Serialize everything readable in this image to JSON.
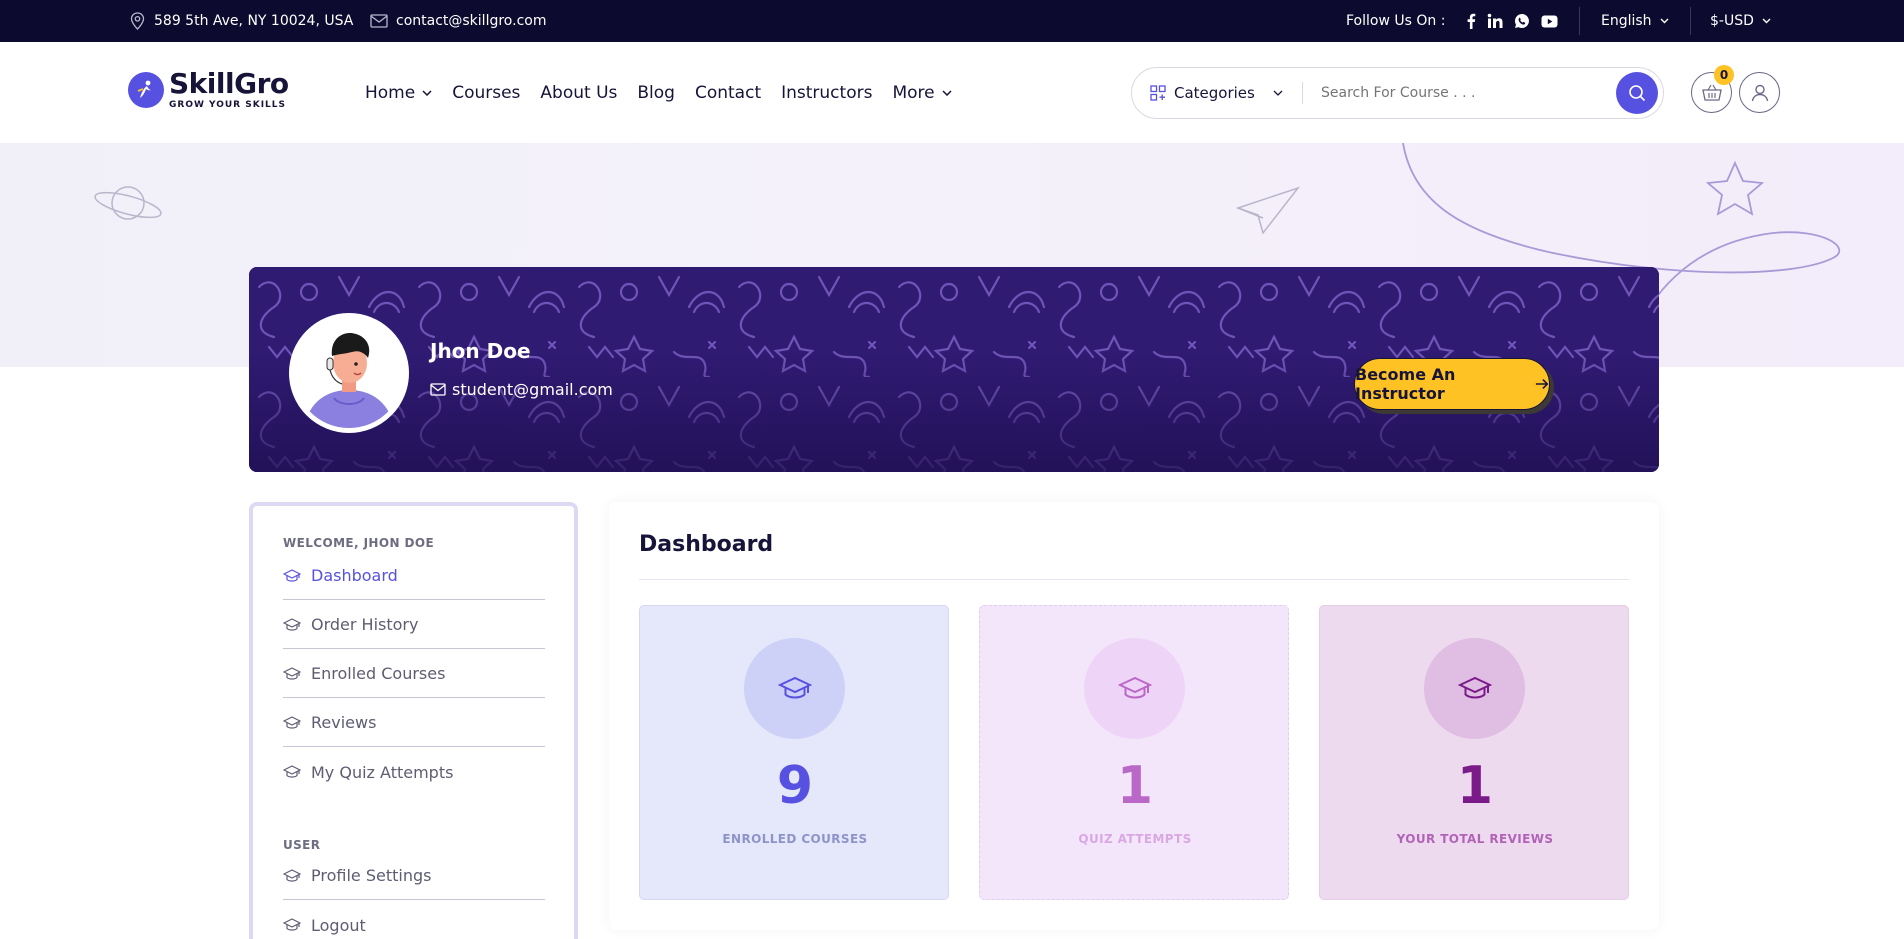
{
  "topbar": {
    "address": "589 5th Ave, NY 10024, USA",
    "email": "contact@skillgro.com",
    "follow_label": "Follow Us On :",
    "language": "English",
    "currency": "$-USD",
    "social_icons": [
      "facebook-icon",
      "linkedin-icon",
      "whatsapp-icon",
      "youtube-icon"
    ]
  },
  "header": {
    "logo_name": "SkillGro",
    "logo_tagline": "GROW YOUR SKILLS",
    "nav": [
      "Home",
      "Courses",
      "About Us",
      "Blog",
      "Contact",
      "Instructors",
      "More"
    ],
    "categories_label": "Categories",
    "search_placeholder": "Search For Course . . .",
    "cart_count": "0"
  },
  "profile": {
    "name": "Jhon Doe",
    "email": "student@gmail.com",
    "become_instructor": "Become An Instructor"
  },
  "sidebar": {
    "welcome": "WELCOME, JHON DOE",
    "items": [
      "Dashboard",
      "Order History",
      "Enrolled Courses",
      "Reviews",
      "My Quiz Attempts"
    ],
    "user_heading": "USER",
    "user_items": [
      "Profile Settings",
      "Logout"
    ]
  },
  "dashboard": {
    "title": "Dashboard",
    "stats": [
      {
        "value": "9",
        "label": "ENROLLED COURSES"
      },
      {
        "value": "1",
        "label": "QUIZ ATTEMPTS"
      },
      {
        "value": "1",
        "label": "YOUR TOTAL REVIEWS"
      }
    ]
  },
  "colors": {
    "primary": "#5751e1",
    "topbar": "#0c0a2f",
    "accent_yellow": "#ffc224",
    "heading": "#161439"
  }
}
